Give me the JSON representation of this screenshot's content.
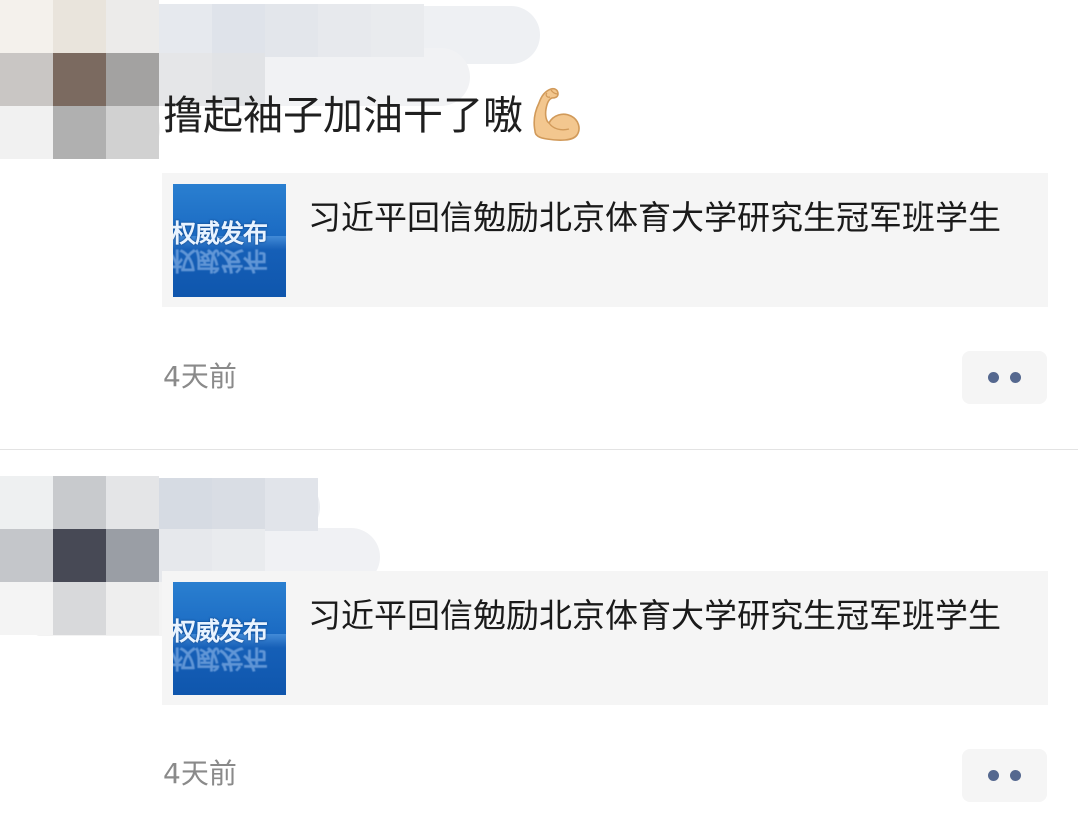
{
  "colors": {
    "background": "#ffffff",
    "card_background": "#f5f5f5",
    "timestamp_text": "#8a8a8a",
    "more_dots": "#55688f",
    "divider": "#e3e3e3",
    "thumb_blue": "#1b6bc3"
  },
  "posts": [
    {
      "user_name": "",
      "comment_text": "撸起袖子加油干了嗷",
      "emoji": "flexed-biceps-icon",
      "link": {
        "thumbnail_text": "权威发布",
        "title": "习近平回信勉励北京体育大学研究生冠军班学生"
      },
      "timestamp": "4天前",
      "more_icon": "more-dots-icon"
    },
    {
      "user_name": "",
      "comment_text": "",
      "link": {
        "thumbnail_text": "权威发布",
        "title": "习近平回信勉励北京体育大学研究生冠军班学生"
      },
      "timestamp": "4天前",
      "more_icon": "more-dots-icon"
    }
  ]
}
